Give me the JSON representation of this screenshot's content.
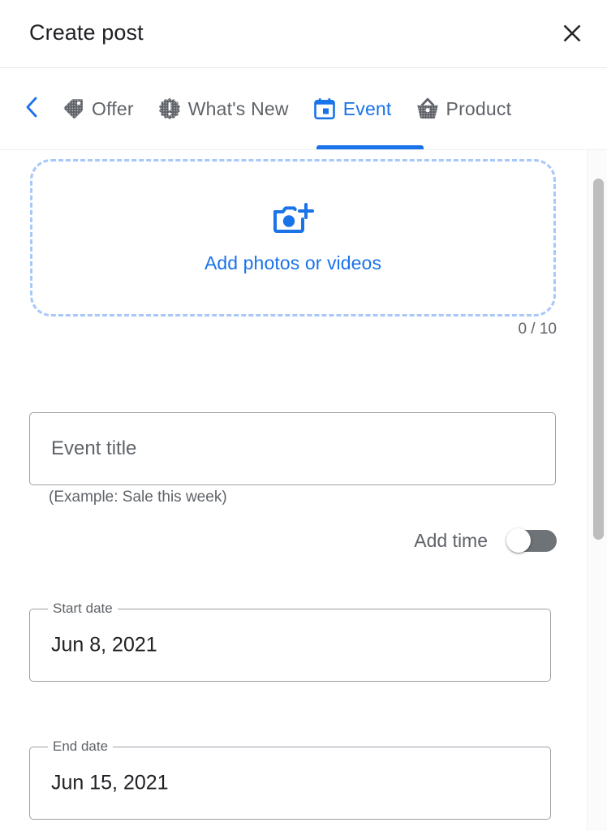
{
  "header": {
    "title": "Create post",
    "close_icon": "close-icon"
  },
  "tabbar": {
    "back_icon": "chevron-left-icon",
    "tabs": [
      {
        "label": "Offer",
        "icon": "tag-icon",
        "active": false
      },
      {
        "label": "What's New",
        "icon": "badge-alert-icon",
        "active": false
      },
      {
        "label": "Event",
        "icon": "calendar-icon",
        "active": true
      },
      {
        "label": "Product",
        "icon": "basket-icon",
        "active": false
      }
    ]
  },
  "media": {
    "dropzone_label": "Add photos or videos",
    "dropzone_icon": "camera-plus-icon",
    "counter": "0 / 10"
  },
  "form": {
    "title_placeholder": "Event title",
    "title_value": "",
    "title_hint": "(Example: Sale this week)",
    "add_time_label": "Add time",
    "add_time_state": "off",
    "start_date": {
      "label": "Start date",
      "value": "Jun 8, 2021"
    },
    "end_date": {
      "label": "End date",
      "value": "Jun 15, 2021"
    }
  },
  "colors": {
    "accent": "#1a73e8",
    "dropzone_border": "#a8c7fa",
    "text_primary": "#202124",
    "text_secondary": "#5f6368",
    "icon_gray": "#5f6368",
    "switch_track": "#6e7378"
  }
}
